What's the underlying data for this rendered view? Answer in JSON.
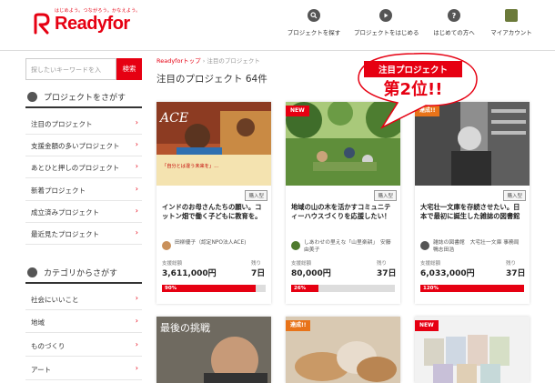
{
  "header": {
    "brand": "Readyfor",
    "tagline": "はじめよう。つながろう。かなえよう。",
    "nav": [
      {
        "label": "プロジェクトを探す",
        "icon": "search-icon"
      },
      {
        "label": "プロジェクトをはじめる",
        "icon": "play-icon"
      },
      {
        "label": "はじめての方へ",
        "icon": "question-icon"
      },
      {
        "label": "マイアカウント",
        "icon": "account-icon"
      }
    ]
  },
  "sidebar": {
    "search_placeholder": "探したいキーワードを入",
    "search_button": "検索",
    "find_title": "プロジェクトをさがす",
    "find_items": [
      "注目のプロジェクト",
      "支援金額の多いプロジェクト",
      "あとひと押しのプロジェクト",
      "新着プロジェクト",
      "成立済みプロジェクト",
      "最近見たプロジェクト"
    ],
    "category_title": "カテゴリからさがす",
    "category_items": [
      "社会にいいこと",
      "地域",
      "ものづくり",
      "アート"
    ],
    "chevron": "›"
  },
  "main": {
    "breadcrumb_home": "Readyforトップ",
    "breadcrumb_sep": " › ",
    "breadcrumb_current": "注目のプロジェクト",
    "title": "注目のプロジェクト 64件",
    "stat_total_label": "支援総額",
    "stat_left_label": "残り",
    "cards": [
      {
        "badge": "",
        "type": "購入型",
        "image_caption": "ACE",
        "image_subtitle": "「自分とは違う未来を」…",
        "title": "インドのお母さんたちの願い。コットン畑で働く子どもに教育を。",
        "owner": "田柳優子（認定NPO法人ACE)",
        "total": "3,611,000円",
        "left": "7日",
        "progress_label": "90%",
        "progress": 90
      },
      {
        "badge": "NEW",
        "type": "購入型",
        "title": "地域の山の木を活かすコミュニティーハウスづくりを応援したい！",
        "owner": "しあわせの里えな「山里楽耕」　安藤 由美子",
        "total": "80,000円",
        "left": "37日",
        "progress_label": "26%",
        "progress": 26
      },
      {
        "badge": "達成!!",
        "type": "購入型",
        "title": "大宅壮一文庫を存続させたい。日本で最初に誕生した雑誌の図書館",
        "owner": "雑誌の図書館　大宅壮一文庫 事務局　鴨志田浩",
        "total": "6,033,000円",
        "left": "37日",
        "progress_label": "120%",
        "progress": 100
      }
    ],
    "row2": [
      {
        "badge": "",
        "caption": "最後の挑戦"
      },
      {
        "badge": "達成!!"
      },
      {
        "badge": "NEW"
      }
    ]
  },
  "callout": {
    "line1": "注目プロジェクト",
    "line2": "第2位!!"
  },
  "colors": {
    "accent": "#e60012",
    "orange": "#e87319"
  }
}
